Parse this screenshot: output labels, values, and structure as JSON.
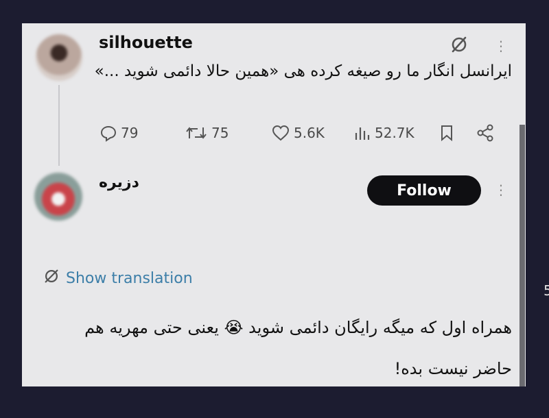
{
  "tweet": {
    "username": "silhouette",
    "text": "ایرانسل انگار ما رو صیغه کرده هی «همین حالا دائمی شوید ...»",
    "stats": {
      "replies": "79",
      "retweets": "75",
      "likes": "5.6K",
      "views": "52.7K"
    }
  },
  "reply": {
    "username": "دزیره",
    "follow_label": "Follow",
    "show_translation_label": "Show translation",
    "text": "همراه اول که میگه رایگان دائمی شوید 😭 یعنی حتی مهریه هم حاضر نیست بده!"
  },
  "edge_text": "5",
  "icons": {
    "translate": "translate-icon",
    "more": "more-vertical-icon",
    "reply": "reply-icon",
    "retweet": "retweet-icon",
    "like": "heart-icon",
    "views": "views-icon",
    "bookmark": "bookmark-icon",
    "share": "share-icon"
  },
  "colors": {
    "background": "#1c1c30",
    "card": "#e8e8ea",
    "link": "#3c7ea8",
    "follow_button": "#0f0f12"
  }
}
